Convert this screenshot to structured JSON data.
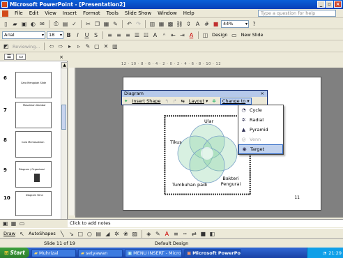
{
  "window": {
    "title": "Microsoft PowerPoint - [Presentation2]",
    "minimize": "_",
    "restore": "▫",
    "close": "×"
  },
  "menu": {
    "items": [
      "File",
      "Edit",
      "View",
      "Insert",
      "Format",
      "Tools",
      "Slide Show",
      "Window",
      "Help"
    ],
    "help_placeholder": "Type a question for help"
  },
  "toolbar": {
    "zoom": "44%"
  },
  "format": {
    "font": "Arial",
    "size": "18",
    "bold": "B",
    "italic": "I",
    "underline": "U",
    "shadow": "S",
    "design": "Design",
    "new_slide": "New Slide"
  },
  "reviewing": {
    "label": "Reviewing..."
  },
  "slides": [
    {
      "num": "6",
      "title": "Cara Mengolah Slide"
    },
    {
      "num": "7",
      "title": "Masukkan Gambar"
    },
    {
      "num": "8",
      "title": "Cara Memasukkan"
    },
    {
      "num": "9",
      "title": "Diagram / Organisasi"
    },
    {
      "num": "10",
      "title": "Diagram Venn"
    }
  ],
  "ruler_text": "12 · 10 · 8 · 6 · 4 · 2 · 0 · 2 · 4 · 6 · 8 · 10 · 12",
  "diagram_toolbar": {
    "title": "Diagram",
    "close": "×",
    "insert_shape": "Insert Shape",
    "layout": "Layout",
    "change_to": "Change to"
  },
  "change_menu": [
    {
      "label": "Cycle",
      "icon": "cycle-icon",
      "glyph": "◔"
    },
    {
      "label": "Radial",
      "icon": "radial-icon",
      "glyph": "✲"
    },
    {
      "label": "Pyramid",
      "icon": "pyramid-icon",
      "glyph": "▲"
    },
    {
      "label": "Venn",
      "icon": "venn-icon",
      "glyph": "◎"
    },
    {
      "label": "Target",
      "icon": "target-icon",
      "glyph": "◉"
    }
  ],
  "venn_labels": {
    "top": "Ular",
    "left": "Tikus",
    "bottom_right": "Bakteri Pengurai",
    "bottom_left": "Tumbuhan padi"
  },
  "slide_number": "11",
  "notes": "Click to add notes",
  "draw": {
    "draw_label": "Draw",
    "autoshapes": "AutoShapes"
  },
  "status": {
    "slide": "Slide 11 of 19",
    "design": "Default Design"
  },
  "taskbar": {
    "start": "Start",
    "tasks": [
      {
        "label": "Muhrizal",
        "active": false
      },
      {
        "label": "setyawan",
        "active": false
      },
      {
        "label": "MENU INSERT - Micros...",
        "active": false
      },
      {
        "label": "Microsoft PowerPoi...",
        "active": true
      }
    ],
    "clock": "21:29"
  },
  "colors": {
    "title_bar": "#0a5fd8",
    "accent": "#316ac5",
    "venn_fill": "#8fd3a8",
    "taskbar": "#245edc"
  }
}
